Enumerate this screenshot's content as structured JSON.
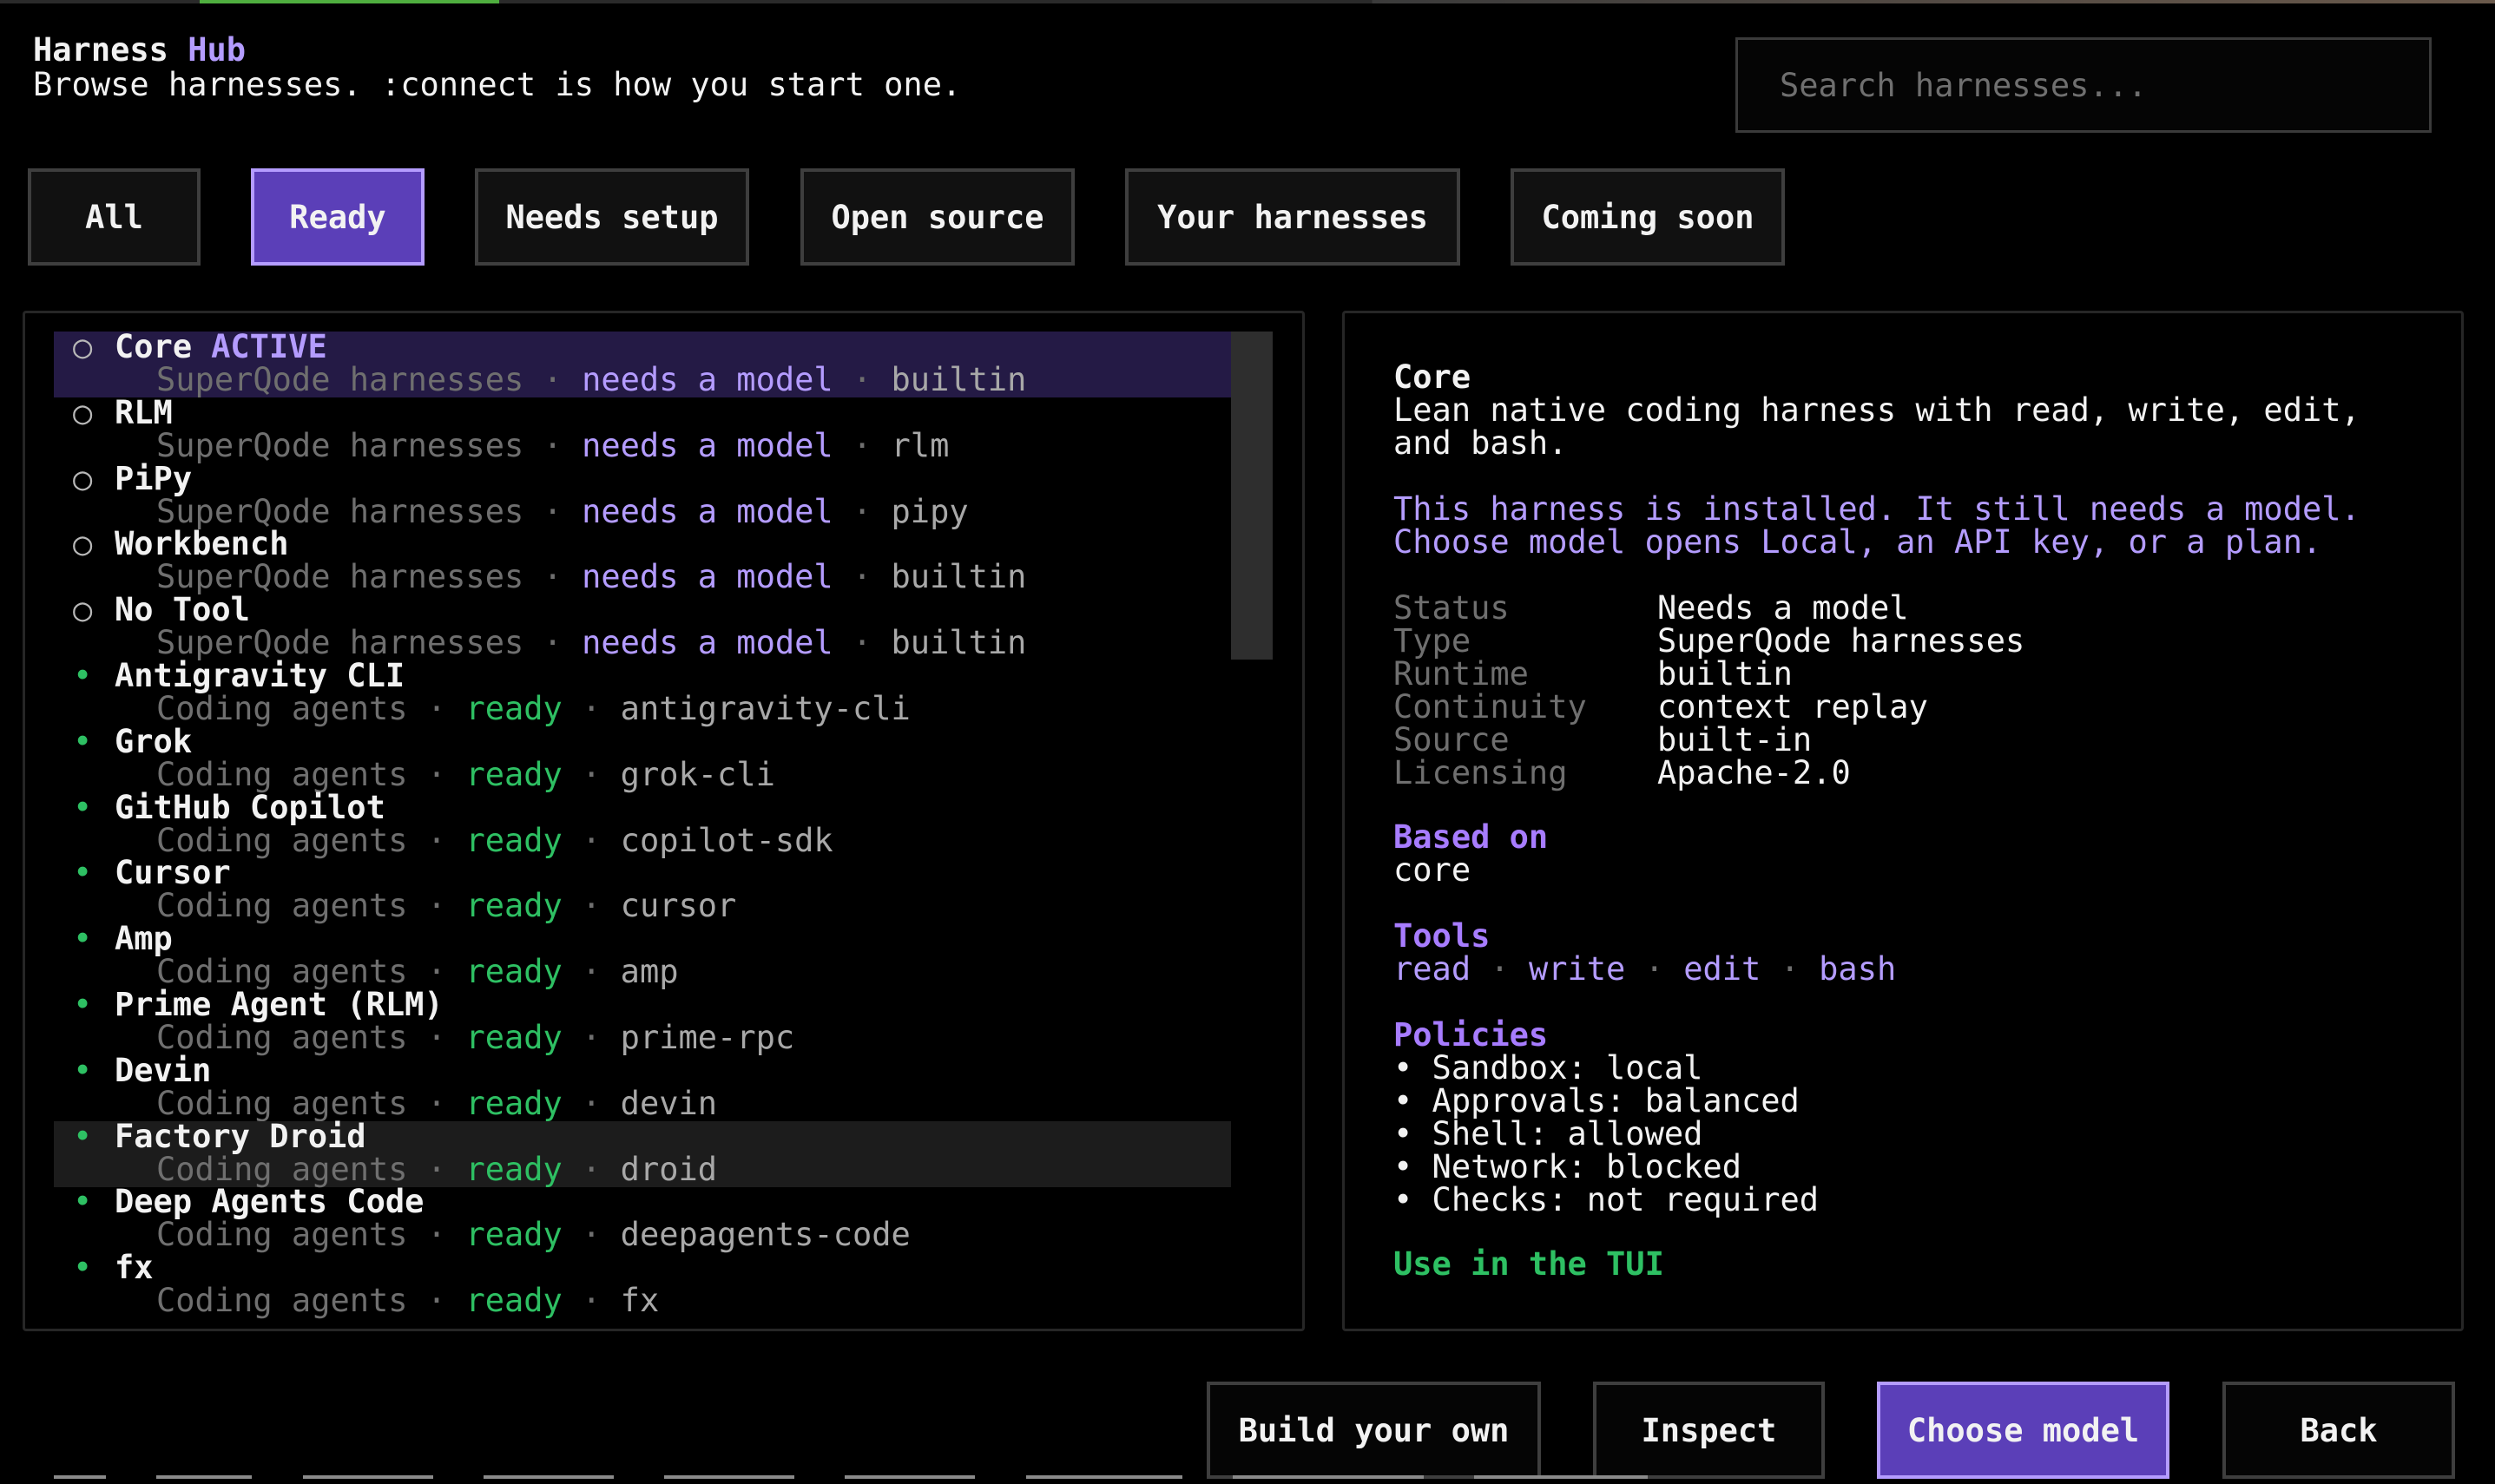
{
  "header": {
    "title_part1": "Harness",
    "title_part2": "Hub",
    "subtitle": "Browse harnesses. :connect is how you start one."
  },
  "search": {
    "placeholder": "Search harnesses..."
  },
  "filters": [
    {
      "label": "All",
      "active": false
    },
    {
      "label": "Ready",
      "active": true
    },
    {
      "label": "Needs setup",
      "active": false
    },
    {
      "label": "Open source",
      "active": false
    },
    {
      "label": "Your harnesses",
      "active": false
    },
    {
      "label": "Coming soon",
      "active": false
    }
  ],
  "list": {
    "items": [
      {
        "name": "Core",
        "badge": "ACTIVE",
        "category": "SuperQode harnesses",
        "status": "needs a model",
        "slug": "builtin",
        "state": "selected"
      },
      {
        "name": "RLM",
        "badge": "",
        "category": "SuperQode harnesses",
        "status": "needs a model",
        "slug": "rlm",
        "state": ""
      },
      {
        "name": "PiPy",
        "badge": "",
        "category": "SuperQode harnesses",
        "status": "needs a model",
        "slug": "pipy",
        "state": ""
      },
      {
        "name": "Workbench",
        "badge": "",
        "category": "SuperQode harnesses",
        "status": "needs a model",
        "slug": "builtin",
        "state": ""
      },
      {
        "name": "No Tool",
        "badge": "",
        "category": "SuperQode harnesses",
        "status": "needs a model",
        "slug": "builtin",
        "state": ""
      },
      {
        "name": "Antigravity CLI",
        "badge": "",
        "category": "Coding agents",
        "status": "ready",
        "slug": "antigravity-cli",
        "state": ""
      },
      {
        "name": "Grok",
        "badge": "",
        "category": "Coding agents",
        "status": "ready",
        "slug": "grok-cli",
        "state": ""
      },
      {
        "name": "GitHub Copilot",
        "badge": "",
        "category": "Coding agents",
        "status": "ready",
        "slug": "copilot-sdk",
        "state": ""
      },
      {
        "name": "Cursor",
        "badge": "",
        "category": "Coding agents",
        "status": "ready",
        "slug": "cursor",
        "state": ""
      },
      {
        "name": "Amp",
        "badge": "",
        "category": "Coding agents",
        "status": "ready",
        "slug": "amp",
        "state": ""
      },
      {
        "name": "Prime Agent (RLM)",
        "badge": "",
        "category": "Coding agents",
        "status": "ready",
        "slug": "prime-rpc",
        "state": ""
      },
      {
        "name": "Devin",
        "badge": "",
        "category": "Coding agents",
        "status": "ready",
        "slug": "devin",
        "state": ""
      },
      {
        "name": "Factory Droid",
        "badge": "",
        "category": "Coding agents",
        "status": "ready",
        "slug": "droid",
        "state": "hover"
      },
      {
        "name": "Deep Agents Code",
        "badge": "",
        "category": "Coding agents",
        "status": "ready",
        "slug": "deepagents-code",
        "state": ""
      },
      {
        "name": "fx",
        "badge": "",
        "category": "Coding agents",
        "status": "ready",
        "slug": "fx",
        "state": ""
      }
    ],
    "separator": "·"
  },
  "detail": {
    "name": "Core",
    "description_line1": "Lean native coding harness with read, write, edit,",
    "description_line2": "and bash.",
    "notice_line1": "This harness is installed. It still needs a model.",
    "notice_line2": "Choose model opens Local, an API key, or a plan.",
    "properties": [
      {
        "label": "Status",
        "value": "Needs a model"
      },
      {
        "label": "Type",
        "value": "SuperQode harnesses"
      },
      {
        "label": "Runtime",
        "value": "builtin"
      },
      {
        "label": "Continuity",
        "value": "context replay"
      },
      {
        "label": "Source",
        "value": "built-in"
      },
      {
        "label": "Licensing",
        "value": "Apache-2.0"
      }
    ],
    "based_on_heading": "Based on",
    "based_on_value": "core",
    "tools_heading": "Tools",
    "tools": [
      "read",
      "write",
      "edit",
      "bash"
    ],
    "policies_heading": "Policies",
    "policies": [
      "• Sandbox: local",
      "• Approvals: balanced",
      "• Shell: allowed",
      "• Network: blocked",
      "• Checks: not required"
    ],
    "use_link": "Use in the TUI"
  },
  "actions": {
    "build": "Build your own",
    "inspect": "Inspect",
    "choose_model": "Choose model",
    "back": "Back"
  },
  "colors": {
    "accent": "#b49cff",
    "accent_fill": "#5b3fb8",
    "ready": "#2ec063",
    "muted": "#6f6f6f",
    "background": "#000000"
  }
}
